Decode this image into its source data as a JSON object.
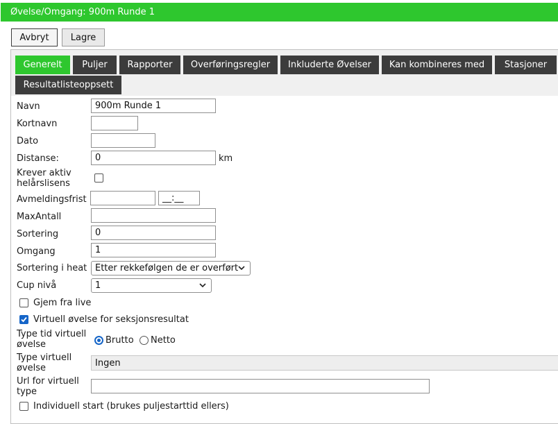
{
  "header": {
    "title": "Øvelse/Omgang: 900m Runde 1"
  },
  "actions": {
    "cancel": "Avbryt",
    "save": "Lagre"
  },
  "tabs": [
    {
      "label": "Generelt",
      "active": true
    },
    {
      "label": "Puljer"
    },
    {
      "label": "Rapporter"
    },
    {
      "label": "Overføringsregler"
    },
    {
      "label": "Inkluderte Øvelser"
    },
    {
      "label": "Kan kombineres med"
    },
    {
      "label": "Stasjoner"
    },
    {
      "label": "Resultatlisteoppsett"
    }
  ],
  "form": {
    "navn": {
      "label": "Navn",
      "value": "900m Runde 1"
    },
    "kortnavn": {
      "label": "Kortnavn",
      "value": ""
    },
    "dato": {
      "label": "Dato",
      "value": ""
    },
    "distanse": {
      "label": "Distanse:",
      "value": "0",
      "unit": "km"
    },
    "krever_lisens": {
      "label_line1": "Krever aktiv",
      "label_line2": "helårslisens",
      "checked": false
    },
    "avmeldingsfrist": {
      "label": "Avmeldingsfrist",
      "date_value": "",
      "time_placeholder": "__:__"
    },
    "maxantall": {
      "label": "MaxAntall",
      "value": ""
    },
    "sortering": {
      "label": "Sortering",
      "value": "0"
    },
    "omgang": {
      "label": "Omgang",
      "value": "1"
    },
    "sortering_heat": {
      "label": "Sortering i heat",
      "value": "Etter rekkefølgen de er overført"
    },
    "cup_niva": {
      "label": "Cup nivå",
      "value": "1"
    },
    "gjem_fra_live": {
      "label": "Gjem fra live",
      "checked": false
    },
    "virtuell_ovelse": {
      "label": "Virtuell øvelse for seksjonsresultat",
      "checked": true
    },
    "type_tid": {
      "label_line1": "Type tid virtuell",
      "label_line2": "øvelse",
      "options": [
        "Brutto",
        "Netto"
      ],
      "selected": "Brutto"
    },
    "type_virtuell": {
      "label_line1": "Type virtuell",
      "label_line2": "øvelse",
      "value": "Ingen"
    },
    "url_virtuell": {
      "label_line1": "Url for virtuell",
      "label_line2": "type",
      "value": ""
    },
    "individuell_start": {
      "label": "Individuell start (brukes puljestarttid ellers)",
      "checked": false
    }
  },
  "colors": {
    "accent": "#2ec72e",
    "tab_dark": "#3c3c3c",
    "check_blue": "#1565c8"
  }
}
